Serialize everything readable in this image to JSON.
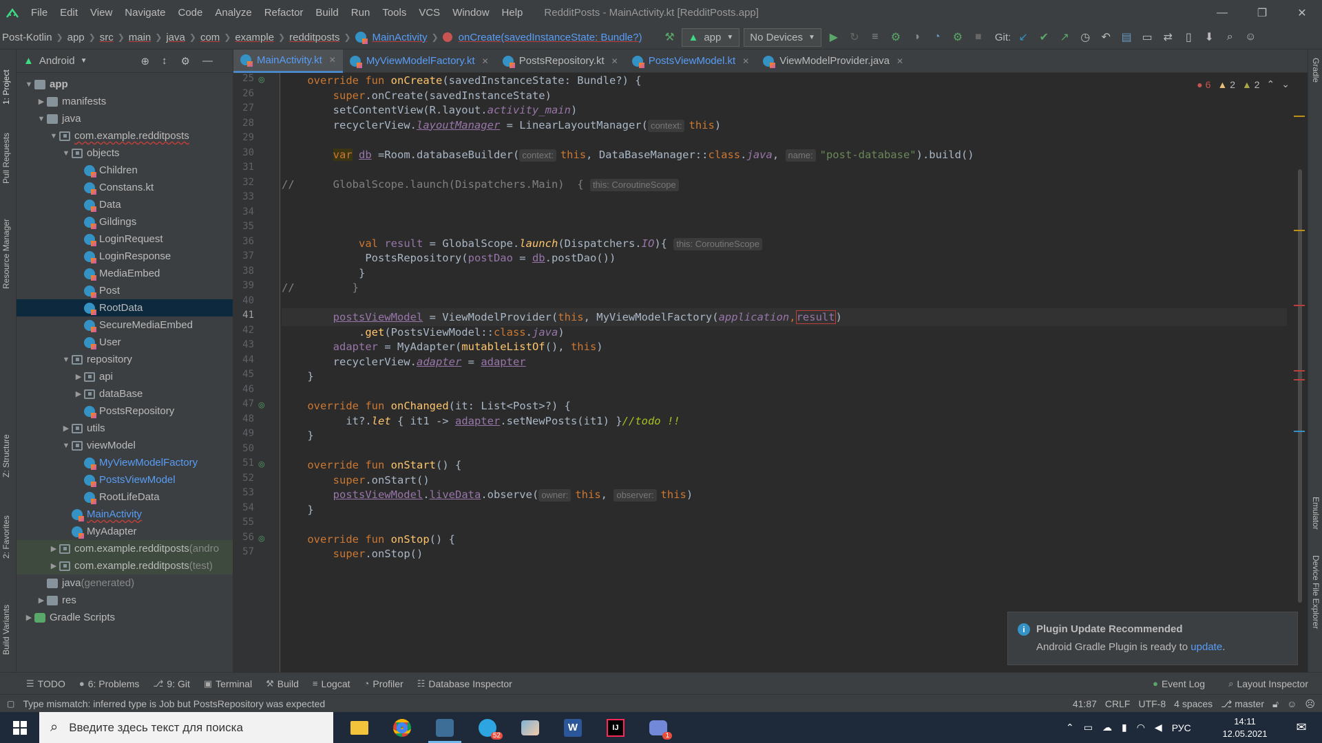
{
  "menubar": {
    "items": [
      "File",
      "Edit",
      "View",
      "Navigate",
      "Code",
      "Analyze",
      "Refactor",
      "Build",
      "Run",
      "Tools",
      "VCS",
      "Window",
      "Help"
    ],
    "title": "RedditPosts - MainActivity.kt [RedditPosts.app]"
  },
  "navbar": {
    "crumbs": [
      "Post-Kotlin",
      "app",
      "src",
      "main",
      "java",
      "com",
      "example",
      "redditposts",
      "MainActivity",
      "onCreate(savedInstanceState: Bundle?)"
    ],
    "run_config": "app",
    "device": "No Devices",
    "git_label": "Git:"
  },
  "leftstrip": {
    "labels": [
      "1: Project",
      "Pull Requests",
      "Resource Manager",
      "Z: Structure",
      "2: Favorites",
      "Build Variants"
    ]
  },
  "rightstrip": {
    "labels": [
      "Gradle",
      "Emulator",
      "Device File Explorer"
    ]
  },
  "project": {
    "view": "Android",
    "tree": [
      {
        "label": "app",
        "depth": 0,
        "icon": "folder",
        "arrow": "down"
      },
      {
        "label": "manifests",
        "depth": 1,
        "icon": "folder",
        "arrow": "right"
      },
      {
        "label": "java",
        "depth": 1,
        "icon": "folder",
        "arrow": "down"
      },
      {
        "label": "com.example.redditposts",
        "depth": 2,
        "icon": "pkg",
        "arrow": "down",
        "err": true
      },
      {
        "label": "objects",
        "depth": 3,
        "icon": "pkg",
        "arrow": "down"
      },
      {
        "label": "Children",
        "depth": 4,
        "icon": "kt"
      },
      {
        "label": "Constans.kt",
        "depth": 4,
        "icon": "kt"
      },
      {
        "label": "Data",
        "depth": 4,
        "icon": "kt"
      },
      {
        "label": "Gildings",
        "depth": 4,
        "icon": "kt"
      },
      {
        "label": "LoginRequest",
        "depth": 4,
        "icon": "kt"
      },
      {
        "label": "LoginResponse",
        "depth": 4,
        "icon": "kt"
      },
      {
        "label": "MediaEmbed",
        "depth": 4,
        "icon": "kt"
      },
      {
        "label": "Post",
        "depth": 4,
        "icon": "kt"
      },
      {
        "label": "RootData",
        "depth": 4,
        "icon": "kt",
        "selected": true
      },
      {
        "label": "SecureMediaEmbed",
        "depth": 4,
        "icon": "kt"
      },
      {
        "label": "User",
        "depth": 4,
        "icon": "kt"
      },
      {
        "label": "repository",
        "depth": 3,
        "icon": "pkg",
        "arrow": "down"
      },
      {
        "label": "api",
        "depth": 4,
        "icon": "pkg",
        "arrow": "right"
      },
      {
        "label": "dataBase",
        "depth": 4,
        "icon": "pkg",
        "arrow": "right"
      },
      {
        "label": "PostsRepository",
        "depth": 4,
        "icon": "kt"
      },
      {
        "label": "utils",
        "depth": 3,
        "icon": "pkg",
        "arrow": "right"
      },
      {
        "label": "viewModel",
        "depth": 3,
        "icon": "pkg",
        "arrow": "down"
      },
      {
        "label": "MyViewModelFactory",
        "depth": 4,
        "icon": "kt",
        "blue": true
      },
      {
        "label": "PostsViewModel",
        "depth": 4,
        "icon": "kt",
        "blue": true
      },
      {
        "label": "RootLifeData",
        "depth": 4,
        "icon": "kt"
      },
      {
        "label": "MainActivity",
        "depth": 3,
        "icon": "kt",
        "blue": true,
        "err": true
      },
      {
        "label": "MyAdapter",
        "depth": 3,
        "icon": "kt"
      },
      {
        "label": "com.example.redditposts",
        "suffix": " (andro",
        "depth": 2,
        "icon": "pkg",
        "arrow": "right",
        "green": true
      },
      {
        "label": "com.example.redditposts",
        "suffix": " (test)",
        "depth": 2,
        "icon": "pkg",
        "arrow": "right",
        "green": true
      },
      {
        "label": "java",
        "suffix": " (generated)",
        "depth": 1,
        "icon": "folder"
      },
      {
        "label": "res",
        "depth": 1,
        "icon": "folder",
        "arrow": "right"
      },
      {
        "label": "Gradle Scripts",
        "depth": 0,
        "icon": "gradle",
        "arrow": "right"
      }
    ]
  },
  "tabs": [
    {
      "label": "MainActivity.kt",
      "active": true
    },
    {
      "label": "MyViewModelFactory.kt",
      "blue": true
    },
    {
      "label": "PostsRepository.kt"
    },
    {
      "label": "PostsViewModel.kt",
      "blue": true
    },
    {
      "label": "ViewModelProvider.java"
    }
  ],
  "inspections": {
    "errors": "6",
    "warnings": "2",
    "weak": "2"
  },
  "code_lines": [
    25,
    26,
    27,
    28,
    29,
    30,
    31,
    32,
    33,
    34,
    35,
    36,
    37,
    38,
    39,
    40,
    41,
    42,
    43,
    44,
    45,
    46,
    47,
    48,
    49,
    50,
    51,
    52,
    53,
    54,
    55,
    56,
    57
  ],
  "code": {
    "l25": [
      "override",
      "fun",
      "onCreate",
      "(savedInstanceState: Bundle?) {"
    ],
    "l26": [
      "super",
      ".onCreate(savedInstanceState)"
    ],
    "l27": [
      "setContentView(R.layout.",
      "activity_main",
      ")"
    ],
    "l28": [
      "recyclerView.",
      "layoutManager",
      " = LinearLayoutManager(",
      "context:",
      "this",
      ")"
    ],
    "l30": [
      "var",
      "db",
      " =Room.databaseBuilder(",
      "context:",
      "this",
      ", DataBaseManager::",
      "class",
      ".",
      "java",
      ", ",
      "name:",
      "\"post-database\"",
      ").build()"
    ],
    "l32": [
      "//",
      "GlobalScope.launch(Dispatchers.Main)  {",
      "this: CoroutineScope"
    ],
    "l36": [
      "val",
      "result",
      " = GlobalScope.",
      "launch",
      "(Dispatchers.",
      "IO",
      "){",
      "this: CoroutineScope"
    ],
    "l37": [
      "PostsRepository(",
      "postDao",
      " = ",
      "db",
      ".postDao())"
    ],
    "l38": [
      "}"
    ],
    "l39": [
      "//",
      "}"
    ],
    "l41": [
      "postsViewModel",
      " = ViewModelProvider(",
      "this",
      ", MyViewModelFactory(",
      "application",
      ",",
      "result",
      ")"
    ],
    "l42": [
      ".",
      "get",
      "(PostsViewModel::",
      "class",
      ".",
      "java",
      ")"
    ],
    "l43": [
      "adapter",
      " = MyAdapter(",
      "mutableListOf",
      "(), ",
      "this",
      ")"
    ],
    "l44": [
      "recyclerView.",
      "adapter",
      " = ",
      "adapter"
    ],
    "l45": [
      "}"
    ],
    "l47": [
      "override",
      "fun",
      "onChanged",
      "(it: List<Post>?) {"
    ],
    "l48": [
      "it?.",
      "let",
      " { it1 -> ",
      "adapter",
      ".setNewPosts(it1) }",
      "//todo !!"
    ],
    "l49": [
      "}"
    ],
    "l51": [
      "override",
      "fun",
      "onStart",
      "() {"
    ],
    "l52": [
      "super",
      ".onStart()"
    ],
    "l53": [
      "postsViewModel",
      ".",
      "liveData",
      ".observe(",
      "owner:",
      "this",
      ", ",
      "observer:",
      "this",
      ")"
    ],
    "l54": [
      "}"
    ],
    "l56": [
      "override",
      "fun",
      "onStop",
      "() {"
    ],
    "l57": [
      "super",
      ".onStop()"
    ]
  },
  "notification": {
    "title": "Plugin Update Recommended",
    "body": "Android Gradle Plugin is ready to ",
    "link": "update",
    "body_end": "."
  },
  "bottom_tools": [
    "TODO",
    "6: Problems",
    "9: Git",
    "Terminal",
    "Build",
    "Logcat",
    "Profiler",
    "Database Inspector"
  ],
  "bottom_right": [
    "Event Log",
    "Layout Inspector"
  ],
  "status": {
    "message": "Type mismatch: inferred type is Job but PostsRepository was expected",
    "position": "41:87",
    "line_sep": "CRLF",
    "encoding": "UTF-8",
    "indent": "4 spaces",
    "branch": "master"
  },
  "taskbar": {
    "search_placeholder": "Введите здесь текст для поиска",
    "telegram_badge": "52",
    "discord_badge": "1",
    "lang": "РУС",
    "time": "14:11",
    "date": "12.05.2021"
  },
  "colors": {
    "accent": "#4a88c7",
    "error": "#bc3f3c",
    "link": "#589df6",
    "keyword": "#cc7832",
    "function": "#ffc66d",
    "string": "#6a8759"
  }
}
